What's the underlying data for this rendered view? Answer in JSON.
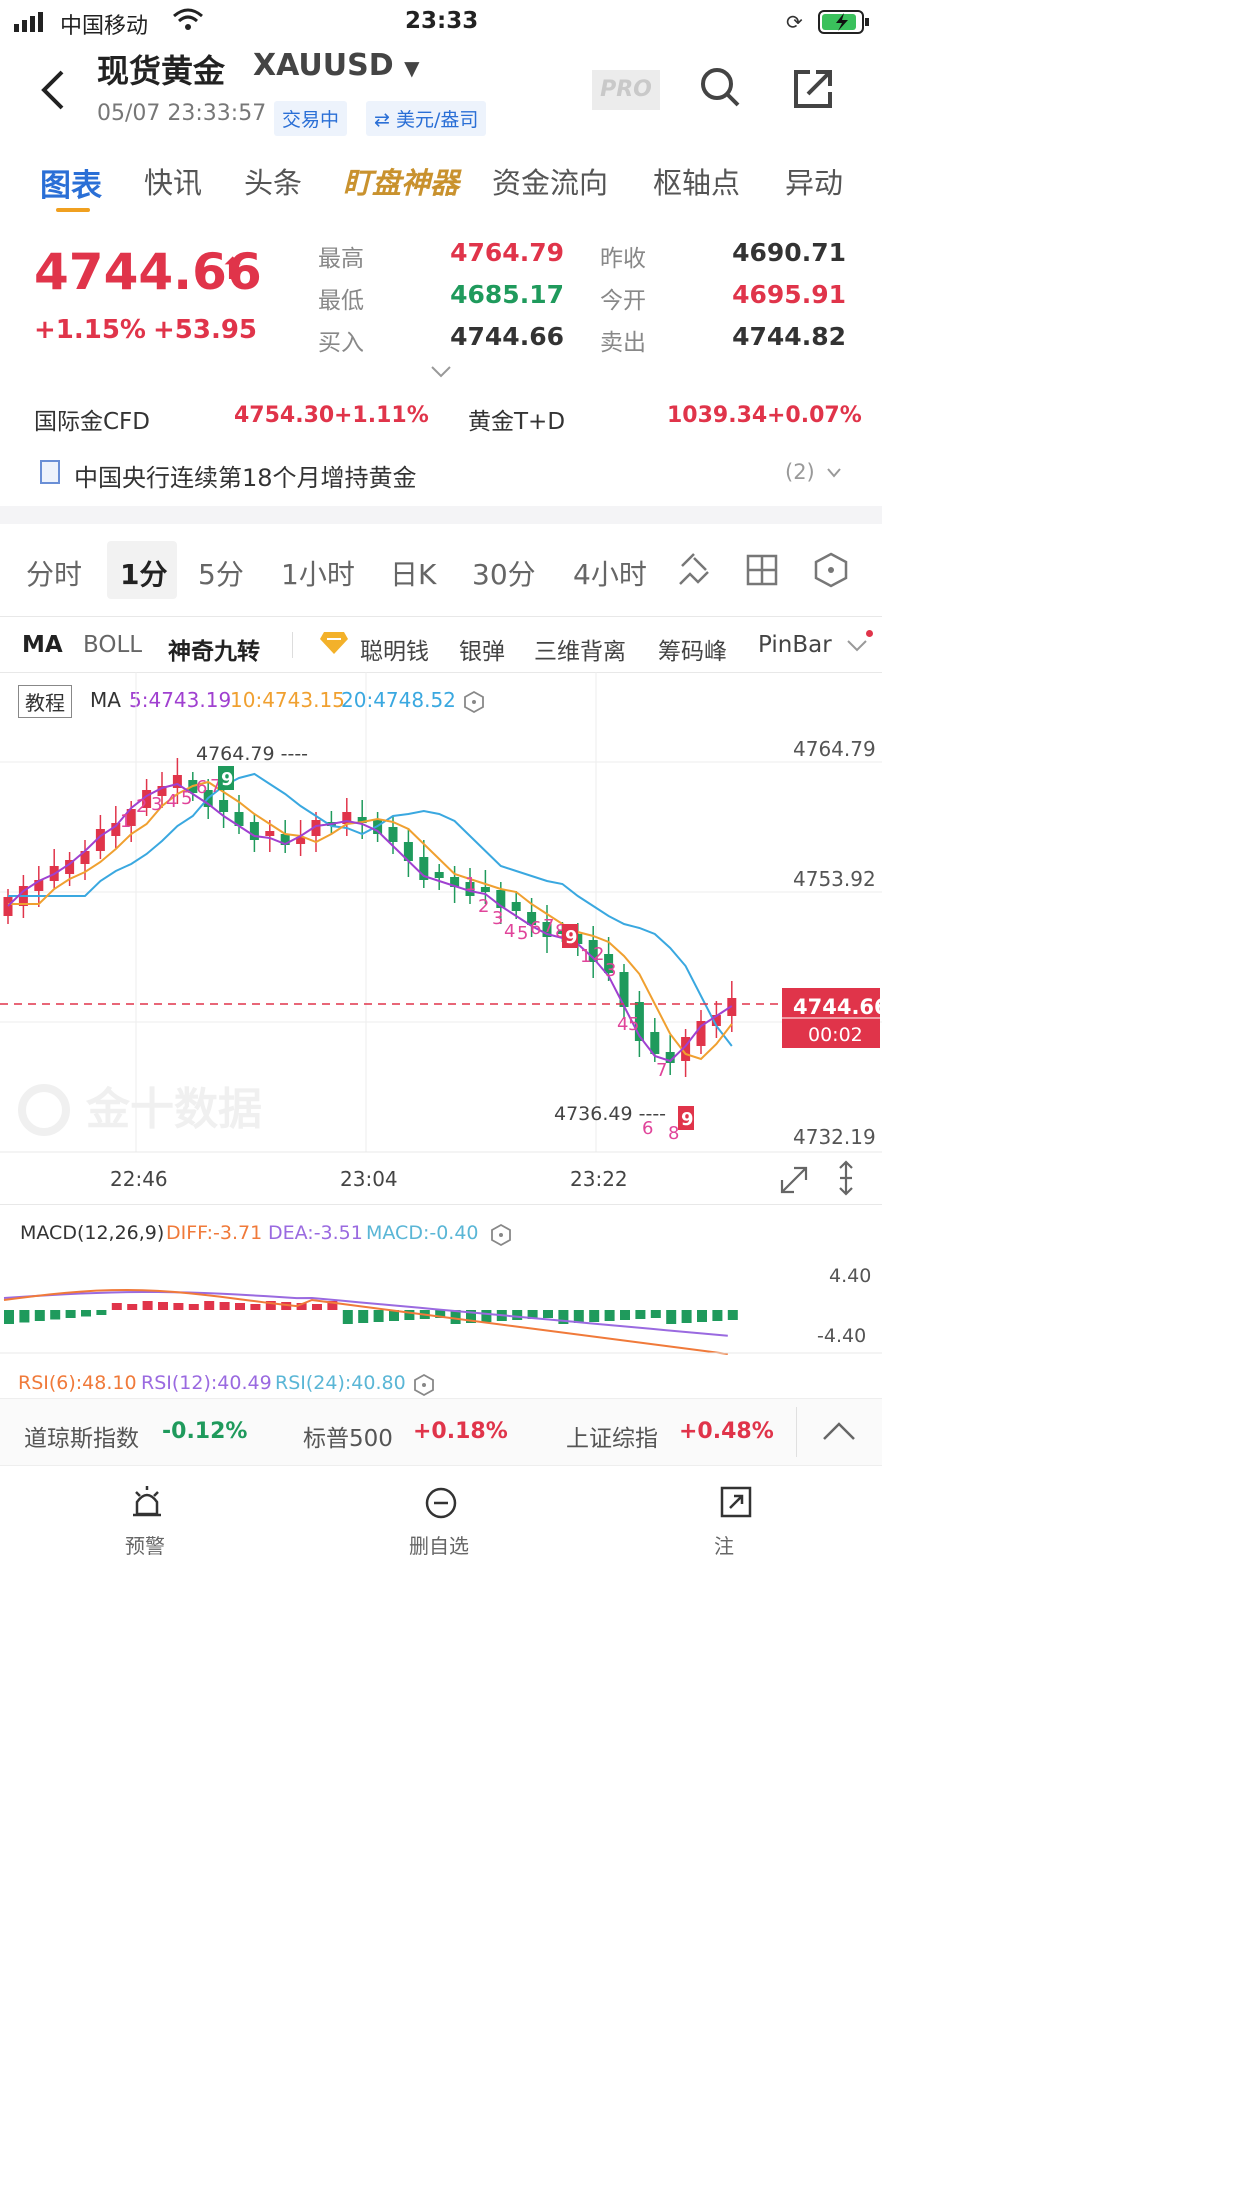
{
  "status_bar": {
    "carrier": "中国移动",
    "time": "23:33"
  },
  "header": {
    "title": "现货黄金",
    "symbol": "XAUUSD",
    "pro": "PRO",
    "datetime": "05/07 23:33:57",
    "trading": "交易中",
    "unit": "⇄ 美元/盎司"
  },
  "tabs": [
    "图表",
    "快讯",
    "头条",
    "盯盘神器",
    "资金流向",
    "枢轴点",
    "异动"
  ],
  "quote": {
    "price": "4744.66",
    "pct": "+1.15%",
    "change": "+53.95",
    "high_label": "最高",
    "high": "4764.79",
    "low_label": "最低",
    "low": "4685.17",
    "buy_label": "买入",
    "buy": "4744.66",
    "prev_label": "昨收",
    "prev": "4690.71",
    "open_label": "今开",
    "open": "4695.91",
    "sell_label": "卖出",
    "sell": "4744.82"
  },
  "related": {
    "cfd_label": "国际金CFD",
    "cfd_value": "4754.30",
    "cfd_pct": "+1.11%",
    "td_label": "黄金T+D",
    "td_value": "1039.34",
    "td_pct": "+0.07%"
  },
  "news": {
    "text": "中国央行连续第18个月增持黄金",
    "count": "(2)"
  },
  "periods": [
    "分时",
    "1分",
    "5分",
    "1小时",
    "日K",
    "30分",
    "4小时"
  ],
  "indicators": [
    "MA",
    "BOLL",
    "神奇九转",
    "聪明钱",
    "银弹",
    "三维背离",
    "筹码峰",
    "PinBar"
  ],
  "ma_legend": {
    "tutorial": "教程",
    "label": "MA",
    "ma5": "5:4743.19",
    "ma10": "10:4743.15",
    "ma20": "20:4748.52"
  },
  "chart": {
    "watermark": "金十数据",
    "high_mark": "4764.79 ----",
    "low_mark": "4736.49 ----",
    "y_top": "4764.79",
    "y_mid": "4753.92",
    "y_bot": "4732.19",
    "price_tag": "4744.66",
    "countdown": "00:02",
    "x_ticks": [
      "22:46",
      "23:04",
      "23:22"
    ],
    "colors": {
      "up": "#e0344a",
      "down": "#1f9a5c",
      "ma5": "#a040d0",
      "ma10": "#f0a030",
      "ma20": "#3aa8e0"
    }
  },
  "chart_data": {
    "type": "candlestick",
    "x": [
      "22:46",
      "23:04",
      "23:22"
    ],
    "ylim": [
      4732.19,
      4764.79
    ],
    "y_ticks": [
      4764.79,
      4753.92,
      4732.19
    ],
    "last": 4744.66,
    "high": 4764.79,
    "low": 4736.49
  },
  "macd": {
    "label": "MACD(12,26,9)",
    "diff": "DIFF:-3.71",
    "dea": "DEA:-3.51",
    "macd": "MACD:-0.40",
    "y_top": "4.40",
    "y_bot": "-4.40"
  },
  "rsi": {
    "rsi6": "RSI(6):48.10",
    "rsi12": "RSI(12):40.49",
    "rsi24": "RSI(24):40.80"
  },
  "indices": [
    {
      "name": "道琼斯指数",
      "pct": "-0.12%"
    },
    {
      "name": "标普500",
      "pct": "+0.18%"
    },
    {
      "name": "上证综指",
      "pct": "+0.48%"
    }
  ],
  "bottom_nav": {
    "alert": "预警",
    "remove": "删自选",
    "share": "注"
  }
}
